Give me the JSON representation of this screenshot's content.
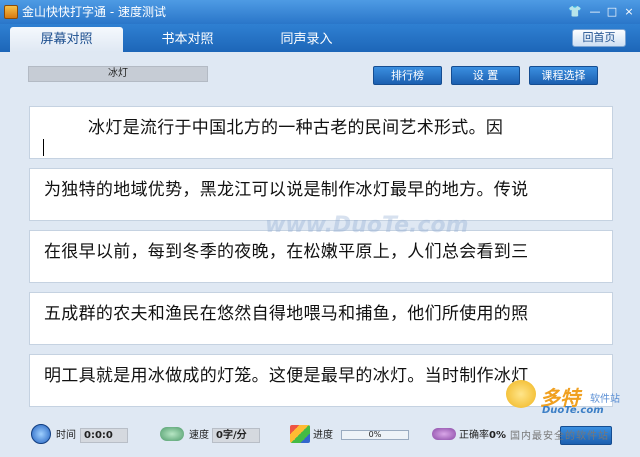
{
  "window": {
    "title": "金山快快打字通 - 速度测试",
    "controls": {
      "skin": "👕",
      "minimize": "—",
      "maximize": "□",
      "close": "×"
    }
  },
  "tabs": [
    {
      "label": "屏幕对照",
      "active": true
    },
    {
      "label": "书本对照",
      "active": false
    },
    {
      "label": "同声录入",
      "active": false
    }
  ],
  "home_button": "回首页",
  "lesson": {
    "name": "冰灯"
  },
  "toolbar": {
    "ranking": "排行榜",
    "settings": "设 置",
    "course_select": "课程选择"
  },
  "text_lines": [
    "冰灯是流行于中国北方的一种古老的民间艺术形式。因",
    "为独特的地域优势，黑龙江可以说是制作冰灯最早的地方。传说",
    "在很早以前，每到冬季的夜晚，在松嫩平原上，人们总会看到三",
    "五成群的农夫和渔民在悠然自得地喂马和捕鱼，他们所使用的照",
    "明工具就是用冰做成的灯笼。这便是最早的冰灯。当时制作冰灯"
  ],
  "watermark": "www.DuoTe.com",
  "status": {
    "time_label": "时间",
    "time_value": "0:0:0",
    "speed_label": "速度",
    "speed_value": "0字/分",
    "progress_label": "进度",
    "progress_value": "0%",
    "progress_fraction": 0,
    "accuracy_label": "正确率",
    "accuracy_value": "0%"
  },
  "corner_watermark": {
    "big": "多特",
    "small": "软件站",
    "site": "DuoTe.com",
    "footer": "国内最安全的软件站"
  },
  "colors": {
    "titlebar": "#2a76c9",
    "tabbar": "#1d66b8",
    "button": "#1b5fb0"
  }
}
